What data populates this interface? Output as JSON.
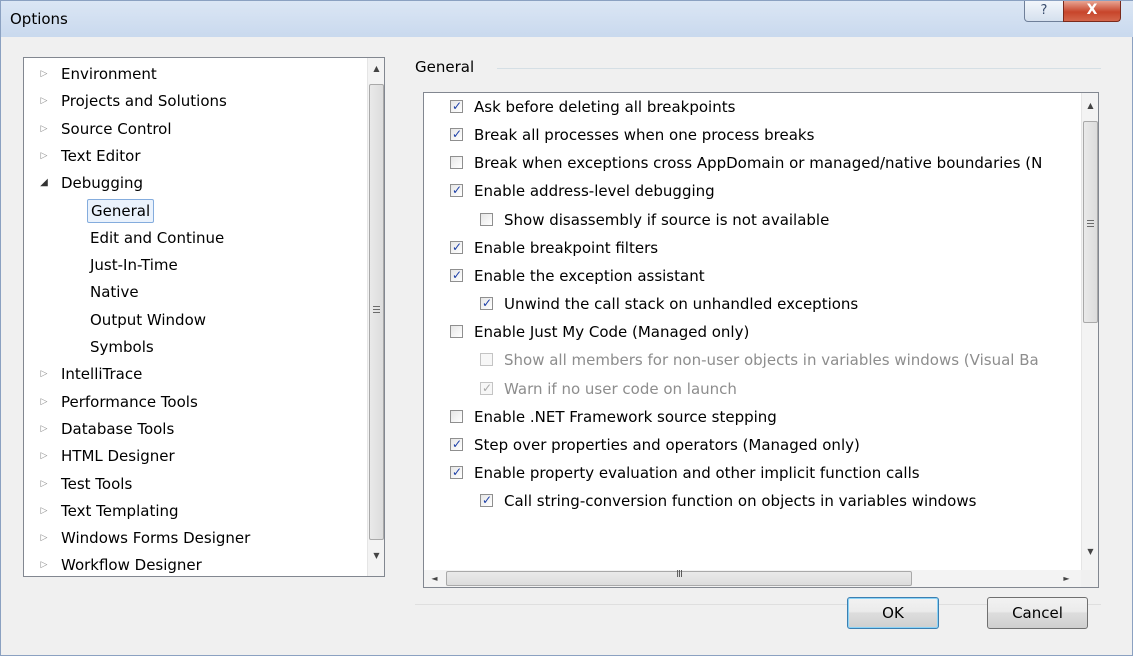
{
  "window": {
    "title": "Options",
    "help_glyph": "?",
    "close_glyph": "X"
  },
  "tree": {
    "scroll_up": "▲",
    "scroll_down": "▼",
    "items": [
      {
        "label": "Environment",
        "level": 0,
        "state": "collapsed"
      },
      {
        "label": "Projects and Solutions",
        "level": 0,
        "state": "collapsed"
      },
      {
        "label": "Source Control",
        "level": 0,
        "state": "collapsed"
      },
      {
        "label": "Text Editor",
        "level": 0,
        "state": "collapsed"
      },
      {
        "label": "Debugging",
        "level": 0,
        "state": "expanded"
      },
      {
        "label": "General",
        "level": 1,
        "state": "leaf",
        "selected": true
      },
      {
        "label": "Edit and Continue",
        "level": 1,
        "state": "leaf"
      },
      {
        "label": "Just-In-Time",
        "level": 1,
        "state": "leaf"
      },
      {
        "label": "Native",
        "level": 1,
        "state": "leaf"
      },
      {
        "label": "Output Window",
        "level": 1,
        "state": "leaf"
      },
      {
        "label": "Symbols",
        "level": 1,
        "state": "leaf"
      },
      {
        "label": "IntelliTrace",
        "level": 0,
        "state": "collapsed"
      },
      {
        "label": "Performance Tools",
        "level": 0,
        "state": "collapsed"
      },
      {
        "label": "Database Tools",
        "level": 0,
        "state": "collapsed"
      },
      {
        "label": "HTML Designer",
        "level": 0,
        "state": "collapsed"
      },
      {
        "label": "Test Tools",
        "level": 0,
        "state": "collapsed"
      },
      {
        "label": "Text Templating",
        "level": 0,
        "state": "collapsed"
      },
      {
        "label": "Windows Forms Designer",
        "level": 0,
        "state": "collapsed"
      },
      {
        "label": "Workflow Designer",
        "level": 0,
        "state": "collapsed"
      }
    ]
  },
  "general": {
    "group_label": "General",
    "scroll_up": "▲",
    "scroll_down": "▼",
    "scroll_left": "◄",
    "scroll_right": "►",
    "hgrip": "III",
    "options": [
      {
        "label": "Ask before deleting all breakpoints",
        "level": 0,
        "checked": true,
        "enabled": true
      },
      {
        "label": "Break all processes when one process breaks",
        "level": 0,
        "checked": true,
        "enabled": true
      },
      {
        "label": "Break when exceptions cross AppDomain or managed/native boundaries (N",
        "level": 0,
        "checked": false,
        "enabled": true
      },
      {
        "label": "Enable address-level debugging",
        "level": 0,
        "checked": true,
        "enabled": true
      },
      {
        "label": "Show disassembly if source is not available",
        "level": 1,
        "checked": false,
        "enabled": true
      },
      {
        "label": "Enable breakpoint filters",
        "level": 0,
        "checked": true,
        "enabled": true
      },
      {
        "label": "Enable the exception assistant",
        "level": 0,
        "checked": true,
        "enabled": true
      },
      {
        "label": "Unwind the call stack on unhandled exceptions",
        "level": 1,
        "checked": true,
        "enabled": true
      },
      {
        "label": "Enable Just My Code (Managed only)",
        "level": 0,
        "checked": false,
        "enabled": true
      },
      {
        "label": "Show all members for non-user objects in variables windows (Visual Ba",
        "level": 1,
        "checked": false,
        "enabled": false
      },
      {
        "label": "Warn if no user code on launch",
        "level": 1,
        "checked": true,
        "enabled": false
      },
      {
        "label": "Enable .NET Framework source stepping",
        "level": 0,
        "checked": false,
        "enabled": true
      },
      {
        "label": "Step over properties and operators (Managed only)",
        "level": 0,
        "checked": true,
        "enabled": true
      },
      {
        "label": "Enable property evaluation and other implicit function calls",
        "level": 0,
        "checked": true,
        "enabled": true
      },
      {
        "label": "Call string-conversion function on objects in variables windows",
        "level": 1,
        "checked": true,
        "enabled": true
      }
    ]
  },
  "buttons": {
    "ok": "OK",
    "cancel": "Cancel"
  }
}
